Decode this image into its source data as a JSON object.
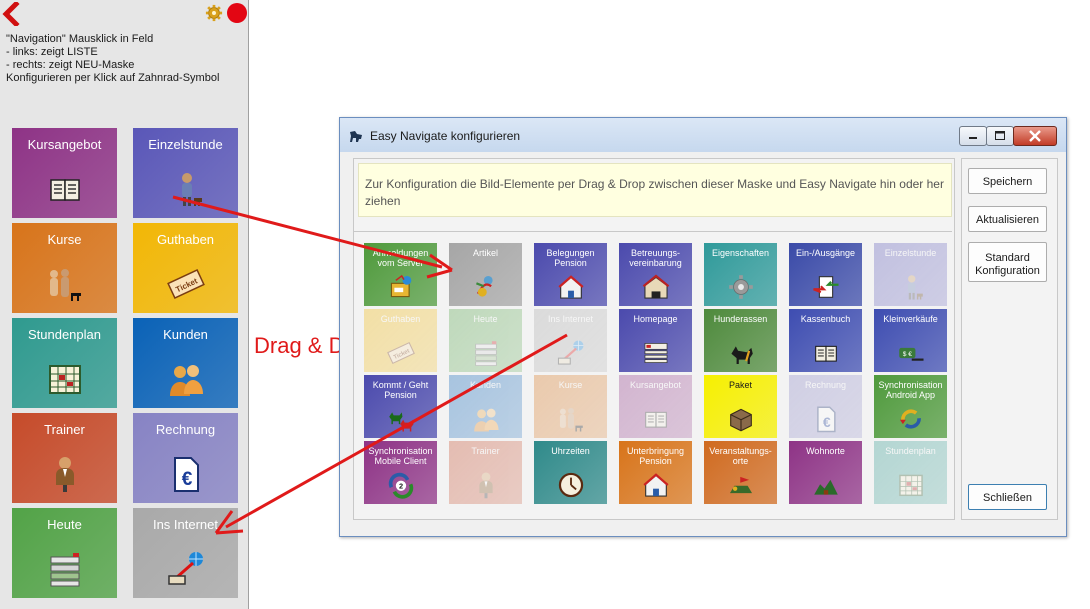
{
  "help_lines": [
    "\"Navigation\" Mausklick in Feld",
    "- links: zeigt LISTE",
    "- rechts: zeigt NEU-Maske",
    "Konfigurieren per Klick auf Zahnrad-Symbol"
  ],
  "left_tiles": [
    {
      "label": "Kursangebot",
      "color": "#8e3386",
      "icon": "book-icon"
    },
    {
      "label": "Einzelstunde",
      "color": "#5a57b8",
      "icon": "trainer-dog-icon"
    },
    {
      "label": "Kurse",
      "color": "#d8741a",
      "icon": "people-dog-icon"
    },
    {
      "label": "Guthaben",
      "color": "#f2b705",
      "icon": "ticket-icon"
    },
    {
      "label": "Stundenplan",
      "color": "#2f9a8f",
      "icon": "calendar-icon"
    },
    {
      "label": "Kunden",
      "color": "#0a62b7",
      "icon": "customers-icon"
    },
    {
      "label": "Trainer",
      "color": "#c64b2a",
      "icon": "trainer-icon"
    },
    {
      "label": "Rechnung",
      "color": "#8783c4",
      "icon": "euro-document-icon"
    },
    {
      "label": "Heute",
      "color": "#52a347",
      "icon": "today-list-icon"
    },
    {
      "label": "Ins Internet",
      "color": "#a9a9a9",
      "icon": "internet-icon"
    }
  ],
  "dialog": {
    "title": "Easy Navigate konfigurieren",
    "info": "Zur Konfiguration die Bild-Elemente per Drag & Drop zwischen dieser Maske und Easy Navigate hin oder her ziehen",
    "buttons": {
      "speichern": "Speichern",
      "aktualisieren": "Aktualisieren",
      "standard_1": "Standard",
      "standard_2": "Konfiguration",
      "schliessen": "Schließen"
    },
    "tiles": [
      {
        "label": "Anmeldungen vom Server",
        "color": "#4f9a3c",
        "faded": false,
        "icon": "server-icon"
      },
      {
        "label": "Artikel",
        "color": "#a6a6a6",
        "faded": false,
        "icon": "article-icon"
      },
      {
        "label": "Belegungen Pension",
        "color": "#4b4aad",
        "faded": false,
        "icon": "house-icon"
      },
      {
        "label": "Betreuungs- vereinbarung",
        "color": "#4b4aad",
        "faded": false,
        "icon": "contract-icon"
      },
      {
        "label": "Eigenschaften",
        "color": "#2f9a9a",
        "faded": false,
        "icon": "gear-icon"
      },
      {
        "label": "Ein-/Ausgänge",
        "color": "#3a4aa8",
        "faded": false,
        "icon": "in-out-icon"
      },
      {
        "label": "Einzelstunde",
        "color": "#5a57b8",
        "faded": true,
        "icon": "trainer-dog-icon"
      },
      {
        "label": "Guthaben",
        "color": "#f2b705",
        "faded": true,
        "icon": "ticket-icon"
      },
      {
        "label": "Heute",
        "color": "#52a347",
        "faded": true,
        "icon": "today-list-icon"
      },
      {
        "label": "Ins Internet",
        "color": "#a9a9a9",
        "faded": true,
        "icon": "internet-icon"
      },
      {
        "label": "Homepage",
        "color": "#4b4aad",
        "faded": false,
        "icon": "homepage-icon"
      },
      {
        "label": "Hunderassen",
        "color": "#4e8a3c",
        "faded": false,
        "icon": "dog-icon"
      },
      {
        "label": "Kassenbuch",
        "color": "#3e4db1",
        "faded": false,
        "icon": "book-icon"
      },
      {
        "label": "Kleinverkäufe",
        "color": "#3e4db1",
        "faded": false,
        "icon": "money-icon"
      },
      {
        "label": "Kommt / Geht Pension",
        "color": "#4b4aad",
        "faded": false,
        "icon": "dogs-icon"
      },
      {
        "label": "Kunden",
        "color": "#0a62b7",
        "faded": true,
        "icon": "customers-icon"
      },
      {
        "label": "Kurse",
        "color": "#d8741a",
        "faded": true,
        "icon": "people-dog-icon"
      },
      {
        "label": "Kursangebot",
        "color": "#8e3386",
        "faded": true,
        "icon": "book-icon"
      },
      {
        "label": "Paket",
        "color": "#f6f000",
        "faded": false,
        "dark": true,
        "icon": "package-icon"
      },
      {
        "label": "Rechnung",
        "color": "#8783c4",
        "faded": true,
        "icon": "euro-document-icon"
      },
      {
        "label": "Synchronisation Android App",
        "color": "#4f9a3c",
        "faded": false,
        "icon": "sync-icon"
      },
      {
        "label": "Synchronisation Mobile Client",
        "color": "#8e3386",
        "faded": false,
        "icon": "sync-2-icon"
      },
      {
        "label": "Trainer",
        "color": "#c64b2a",
        "faded": true,
        "icon": "trainer-icon"
      },
      {
        "label": "Uhrzeiten",
        "color": "#2f8a8a",
        "faded": false,
        "icon": "clock-icon"
      },
      {
        "label": "Unterbringung Pension",
        "color": "#d8741a",
        "faded": false,
        "icon": "house-icon"
      },
      {
        "label": "Veranstaltungs- orte",
        "color": "#d06a1f",
        "faded": false,
        "icon": "place-icon"
      },
      {
        "label": "Wohnorte",
        "color": "#8e3386",
        "faded": false,
        "icon": "map-icon"
      },
      {
        "label": "Stundenplan",
        "color": "#2f9a8f",
        "faded": true,
        "icon": "calendar-icon"
      }
    ]
  },
  "drag_drop_label": "Drag & Drop",
  "arrow_color": "#e01a1a"
}
